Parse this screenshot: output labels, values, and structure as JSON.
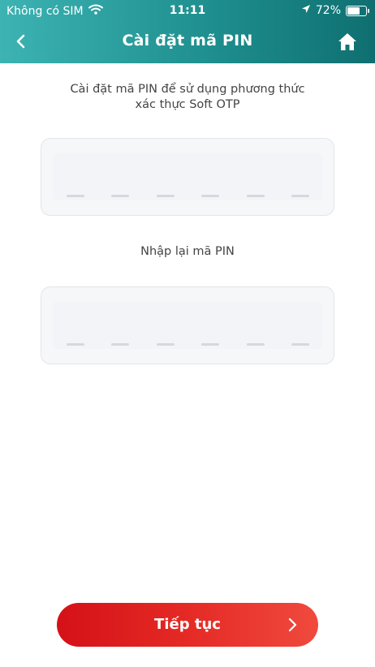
{
  "status_bar": {
    "carrier": "Không có SIM",
    "time": "11:11",
    "battery_percent": "72%",
    "battery_level": 0.72,
    "icons": [
      "wifi-icon",
      "location-arrow-icon",
      "battery-icon"
    ]
  },
  "nav": {
    "title": "Cài đặt mã PIN",
    "back_icon": "chevron-left-icon",
    "home_icon": "home-icon",
    "background_colors": [
      "#3db3b3",
      "#0f6f70"
    ]
  },
  "instruction": {
    "line1": "Cài đặt mã PIN để sử dụng phương thức",
    "line2": "xác thực Soft OTP"
  },
  "pin_fields": {
    "digit_count": 6,
    "pin_value": "",
    "confirm_value": ""
  },
  "reenter_label": "Nhập lại mã PIN",
  "continue_button": {
    "label": "Tiếp tục",
    "icon": "chevron-right-icon",
    "colors": [
      "#d41118",
      "#f04a3d"
    ]
  }
}
